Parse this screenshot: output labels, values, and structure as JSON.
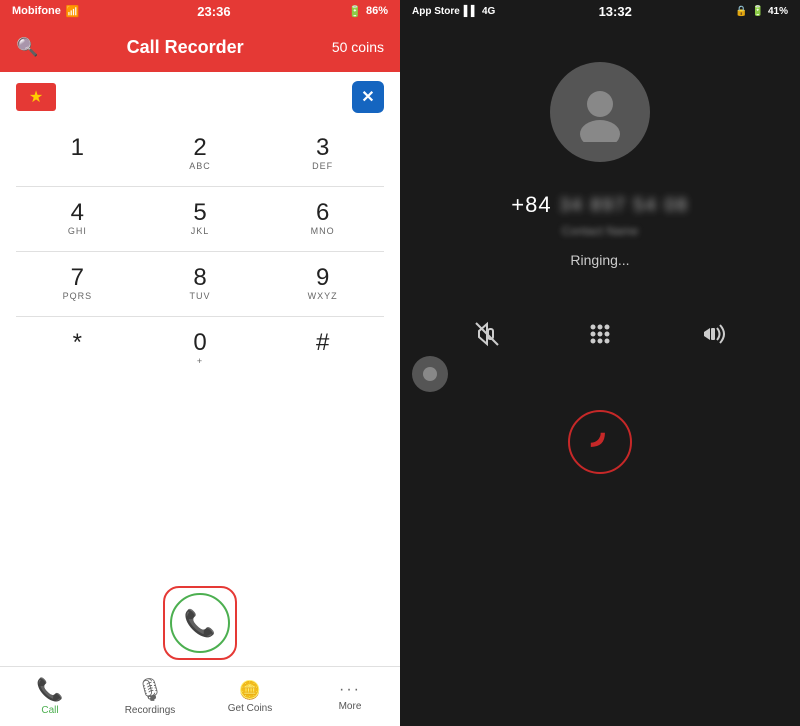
{
  "left": {
    "statusBar": {
      "carrier": "Mobifone",
      "wifi": "▾",
      "time": "23:36",
      "signal": "◉",
      "battery": "86%"
    },
    "header": {
      "searchIcon": "🔍",
      "title": "Call Recorder",
      "coins": "50 coins"
    },
    "flagStar": "★",
    "clearIcon": "✕",
    "dialpad": [
      [
        {
          "num": "1",
          "letters": ""
        },
        {
          "num": "2",
          "letters": "ABC"
        },
        {
          "num": "3",
          "letters": "DEF"
        }
      ],
      [
        {
          "num": "4",
          "letters": "GHI"
        },
        {
          "num": "5",
          "letters": "JKL"
        },
        {
          "num": "6",
          "letters": "MNO"
        }
      ],
      [
        {
          "num": "7",
          "letters": "PQRS"
        },
        {
          "num": "8",
          "letters": "TUV"
        },
        {
          "num": "9",
          "letters": "WXYZ"
        }
      ],
      [
        {
          "num": "*",
          "letters": ""
        },
        {
          "num": "0",
          "letters": "+"
        },
        {
          "num": "#",
          "letters": ""
        }
      ]
    ],
    "bottomNav": [
      {
        "label": "Call",
        "icon": "📞",
        "active": true
      },
      {
        "label": "Recordings",
        "icon": "🎙",
        "active": false
      },
      {
        "label": "Get Coins",
        "icon": "🪙",
        "active": false
      },
      {
        "label": "More",
        "icon": "···",
        "active": false
      }
    ]
  },
  "right": {
    "statusBar": {
      "left": "App Store",
      "signal": "▌▌",
      "network": "4G",
      "time": "13:32",
      "lock": "🔒",
      "signal2": "▲",
      "battery": "41%"
    },
    "phoneNumber": "+84",
    "ringing": "Ringing...",
    "controls": [
      {
        "icon": "🔇",
        "label": "mute"
      },
      {
        "icon": "⠿",
        "label": "keypad"
      },
      {
        "icon": "🔉",
        "label": "speaker"
      }
    ],
    "endCallIcon": "📵"
  }
}
